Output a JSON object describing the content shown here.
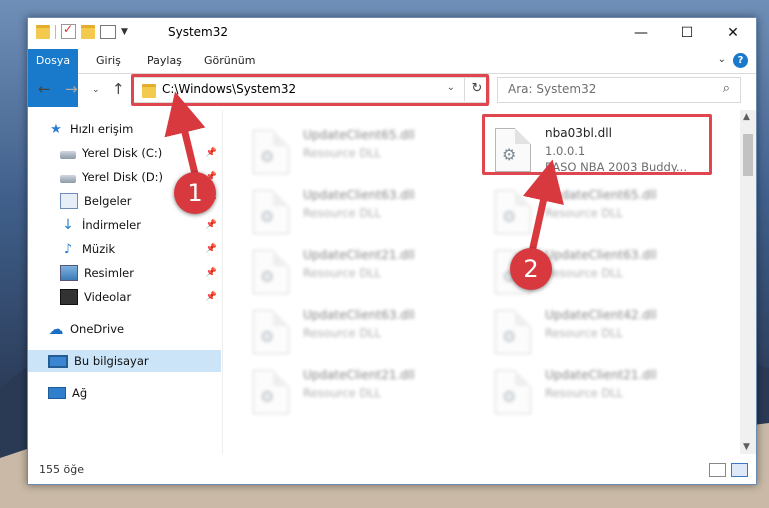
{
  "window": {
    "title": "System32"
  },
  "quick_access_icons": [
    "folder-icon",
    "checkmark-properties-icon",
    "new-folder-icon",
    "properties-icon",
    "dropdown-icon"
  ],
  "window_controls": {
    "minimize": "—",
    "maximize": "☐",
    "close": "✕"
  },
  "ribbon": {
    "tabs": [
      "Dosya",
      "Giriş",
      "Paylaş",
      "Görünüm"
    ],
    "help": "?"
  },
  "address": {
    "path": "C:\\Windows\\System32",
    "search_placeholder": "Ara: System32"
  },
  "nav_pane": {
    "items": [
      {
        "label": "Hızlı erişim",
        "icon": "star-icon",
        "pinned": false
      },
      {
        "label": "Yerel Disk (C:)",
        "icon": "disk-icon",
        "pinned": true
      },
      {
        "label": "Yerel Disk (D:)",
        "icon": "disk-icon",
        "pinned": true
      },
      {
        "label": "Belgeler",
        "icon": "documents-icon",
        "pinned": true
      },
      {
        "label": "İndirmeler",
        "icon": "download-icon",
        "pinned": true
      },
      {
        "label": "Müzik",
        "icon": "music-icon",
        "pinned": true
      },
      {
        "label": "Resimler",
        "icon": "pictures-icon",
        "pinned": true
      },
      {
        "label": "Videolar",
        "icon": "videos-icon",
        "pinned": true
      },
      {
        "label": "OneDrive",
        "icon": "cloud-icon",
        "pinned": false
      },
      {
        "label": "Bu bilgisayar",
        "icon": "computer-icon",
        "pinned": false,
        "selected": true
      },
      {
        "label": "Ağ",
        "icon": "network-icon",
        "pinned": false
      }
    ]
  },
  "files": {
    "left": [
      {
        "name": "UpdateClient65.dll",
        "desc": "Resource DLL"
      },
      {
        "name": "UpdateClient63.dll",
        "desc": "Resource DLL"
      },
      {
        "name": "UpdateClient21.dll",
        "desc": "Resource DLL"
      },
      {
        "name": "UpdateClient63.dll",
        "desc": "Resource DLL"
      },
      {
        "name": "UpdateClient21.dll",
        "desc": "Resource DLL"
      }
    ],
    "highlighted": {
      "name": "nba03bl.dll",
      "version": "1.0.0.1",
      "desc": "EASO NBA 2003 Buddy..."
    },
    "right": [
      {
        "name": "UpdateClient65.dll",
        "desc": "Resource DLL"
      },
      {
        "name": "UpdateClient63.dll",
        "desc": "Resource DLL"
      },
      {
        "name": "UpdateClient42.dll",
        "desc": "Resource DLL"
      },
      {
        "name": "UpdateClient21.dll",
        "desc": "Resource DLL"
      }
    ]
  },
  "status": {
    "count": "155 öğe"
  },
  "callouts": [
    "1",
    "2"
  ],
  "colors": {
    "accent": "#1979ca",
    "callout": "#d8393f",
    "highlight_box": "#e0464e",
    "selection": "#cce4f7"
  }
}
